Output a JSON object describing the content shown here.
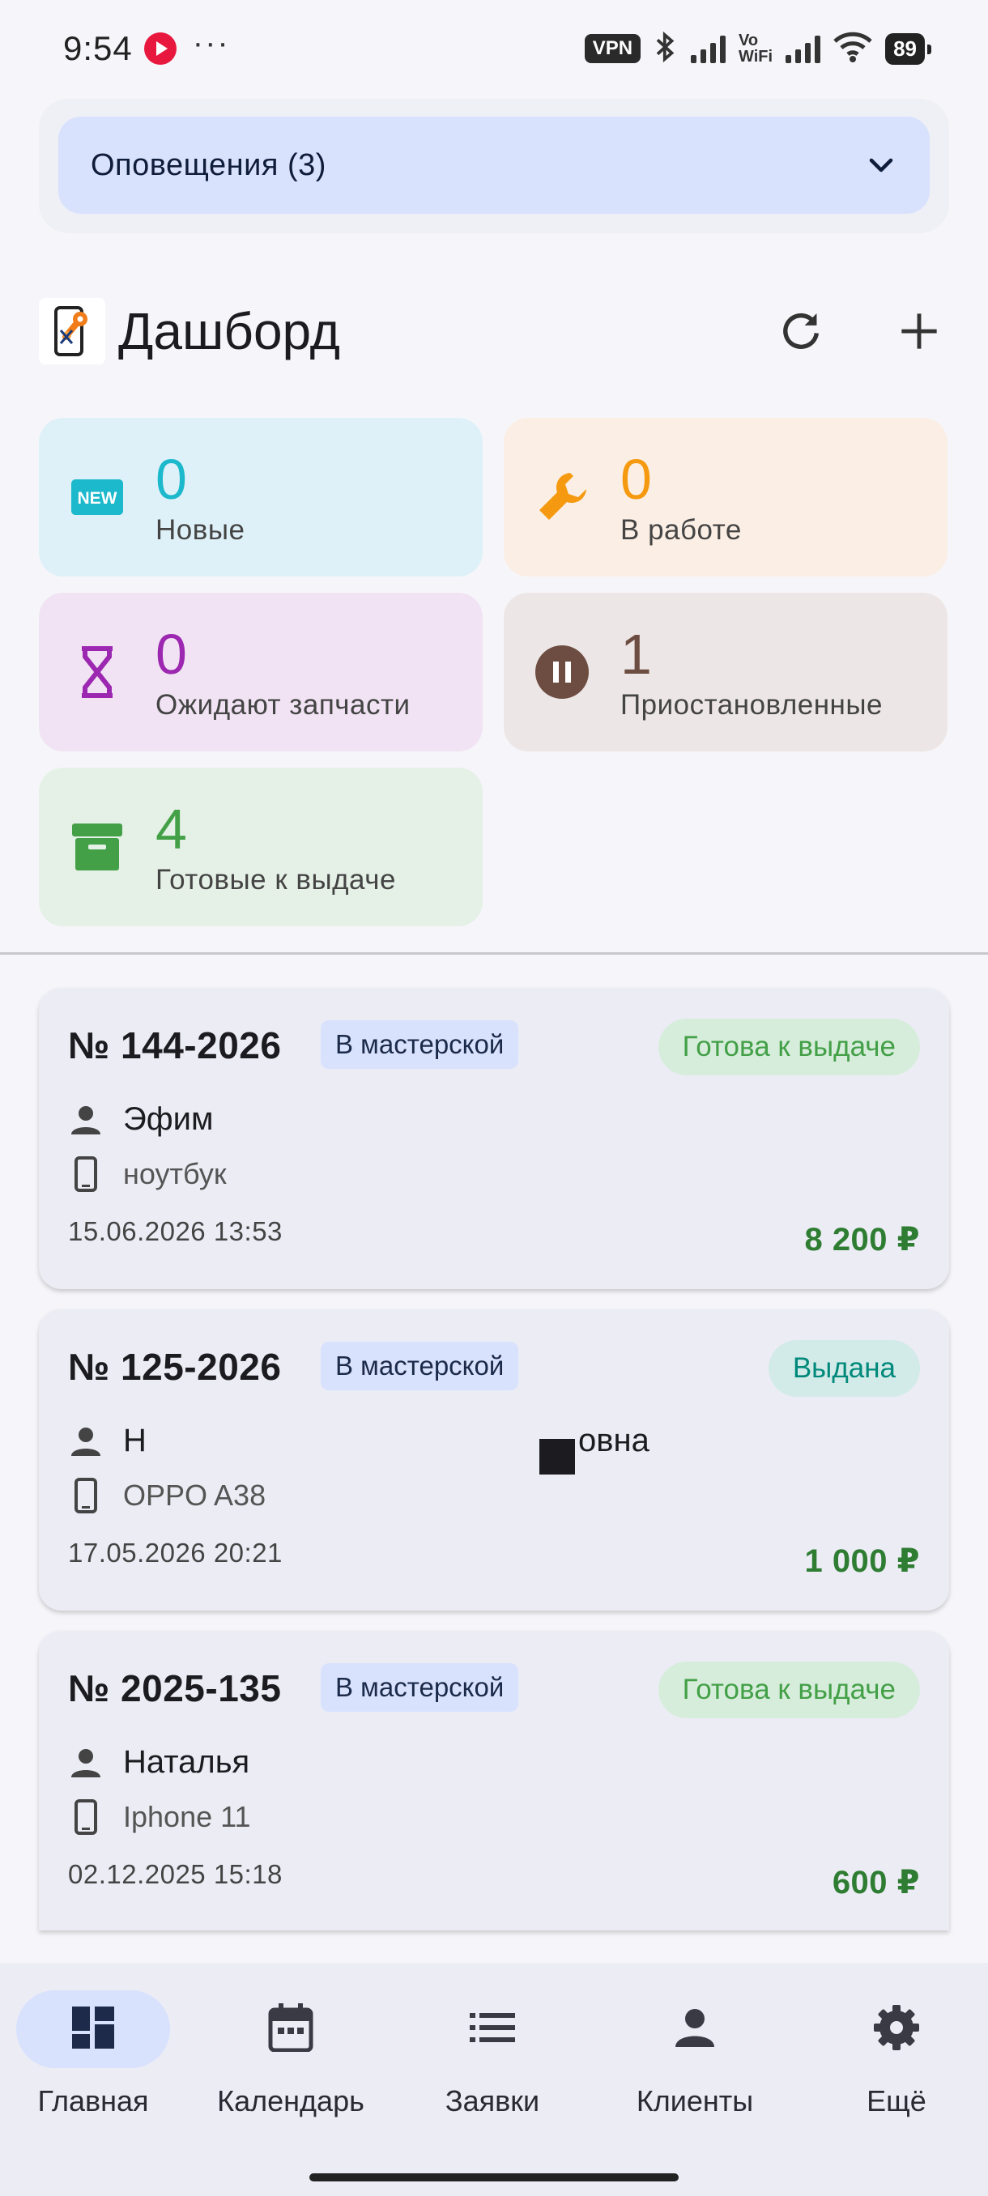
{
  "status_bar": {
    "time": "9:54",
    "dots": "···",
    "vpn": "VPN",
    "volte_top": "Vo",
    "volte_bottom": "WiFi",
    "battery": "89"
  },
  "notifications": {
    "label": "Оповещения (3)"
  },
  "header": {
    "title": "Дашборд"
  },
  "stats": [
    {
      "count": "0",
      "label": "Новые",
      "icon": "new-badge-icon",
      "color": "#1cb8cc",
      "bg": "#dff1f8"
    },
    {
      "count": "0",
      "label": "В работе",
      "icon": "wrench-icon",
      "color": "#f59a10",
      "bg": "#fbeee4"
    },
    {
      "count": "0",
      "label": "Ожидают запчасти",
      "icon": "hourglass-icon",
      "color": "#9c27b0",
      "bg": "#f1e3f3"
    },
    {
      "count": "1",
      "label": "Приостановленные",
      "icon": "pause-icon",
      "color": "#6d4c41",
      "bg": "#ede6e6"
    },
    {
      "count": "4",
      "label": "Готовые к выдаче",
      "icon": "archive-icon",
      "color": "#43a047",
      "bg": "#e5f1e7"
    }
  ],
  "orders": [
    {
      "number": "№ 144-2026",
      "location": "В мастерской",
      "status": "Готова к выдаче",
      "status_bg": "#d7eddc",
      "status_color": "#43a047",
      "client": "Эфим",
      "device": "ноутбук",
      "date": "15.06.2026 13:53",
      "price": "8 200 ₽"
    },
    {
      "number": "№ 125-2026",
      "location": "В мастерской",
      "status": "Выдана",
      "status_bg": "#d2ebe8",
      "status_color": "#00897b",
      "client": "Н",
      "client_tail": "овна",
      "device": "OPPO A38",
      "date": "17.05.2026 20:21",
      "price": "1 000 ₽"
    },
    {
      "number": "№ 2025-135",
      "location": "В мастерской",
      "status": "Готова к выдаче",
      "status_bg": "#d7eddc",
      "status_color": "#43a047",
      "client": "Наталья",
      "device": "Iphone 11",
      "date": "02.12.2025 15:18",
      "price": "600 ₽"
    }
  ],
  "bottom_nav": [
    {
      "label": "Главная",
      "icon": "dashboard-icon",
      "active": true
    },
    {
      "label": "Календарь",
      "icon": "calendar-icon",
      "active": false
    },
    {
      "label": "Заявки",
      "icon": "list-icon",
      "active": false
    },
    {
      "label": "Клиенты",
      "icon": "person-icon",
      "active": false
    },
    {
      "label": "Ещё",
      "icon": "gear-icon",
      "active": false
    }
  ]
}
